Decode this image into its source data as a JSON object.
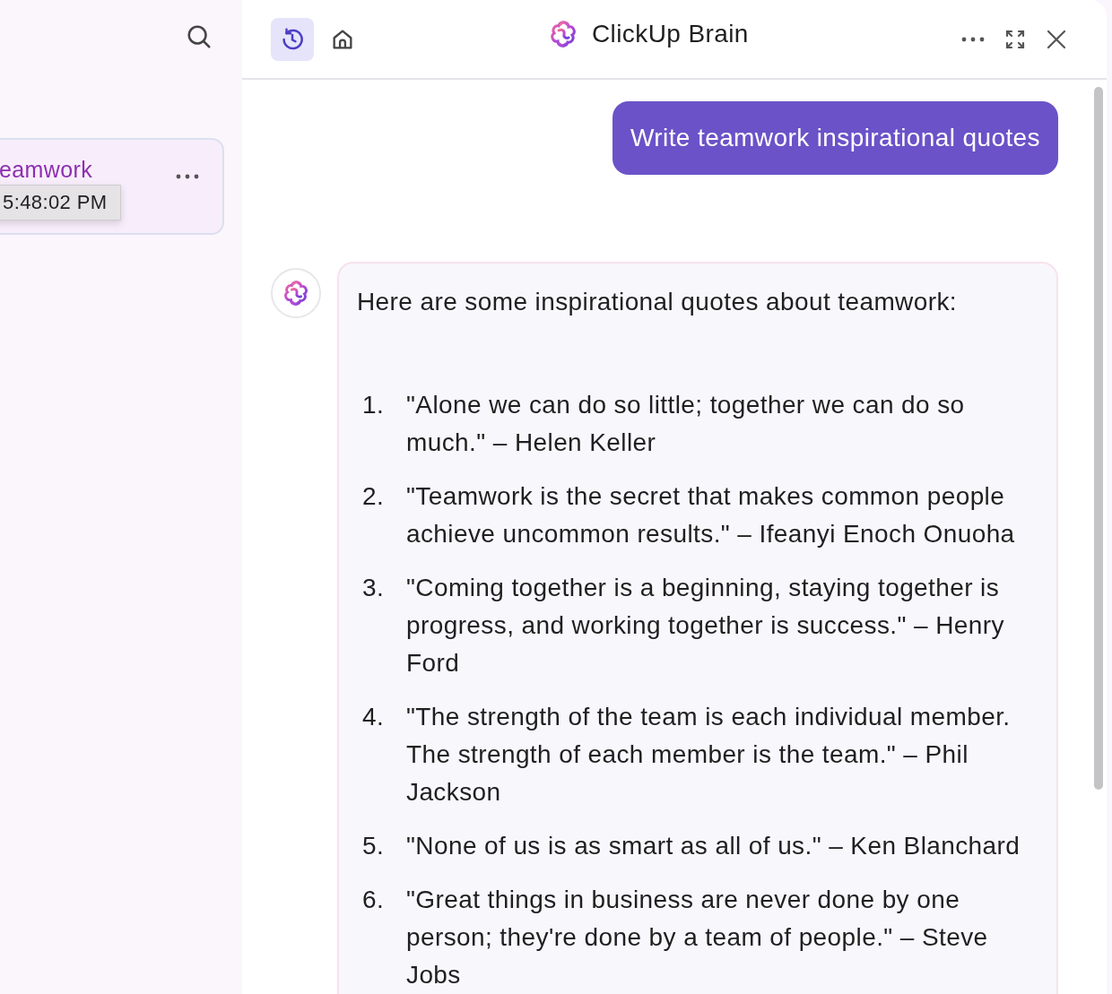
{
  "sidebar": {
    "card": {
      "title": "eamwork",
      "tooltip": "5:48:02 PM"
    }
  },
  "header": {
    "nav": [
      {
        "kind": "history",
        "selected": true
      },
      {
        "kind": "home",
        "selected": false
      }
    ],
    "title": "ClickUp Brain"
  },
  "chat": {
    "user_message": "Write teamwork inspirational quotes",
    "reply": {
      "intro": "Here are some inspirational quotes about teamwork:",
      "items": [
        {
          "number": "1.",
          "text": "\"Alone we can do so little; together we can do so much.\" – Helen Keller"
        },
        {
          "number": "2.",
          "text": "\"Teamwork is the secret that makes common people achieve uncommon results.\" – Ifeanyi Enoch Onuoha"
        },
        {
          "number": "3.",
          "text": "\"Coming together is a beginning, staying together is progress, and working together is success.\" – Henry Ford"
        },
        {
          "number": "4.",
          "text": "\"The strength of the team is each individual member. The strength of each member is the team.\" – Phil Jackson"
        },
        {
          "number": "5.",
          "text": "\"None of us is as smart as all of us.\" – Ken Blanchard"
        },
        {
          "number": "6.",
          "text": "\"Great things in business are never done by one person; they're done by a team of people.\" – Steve Jobs"
        }
      ]
    }
  }
}
